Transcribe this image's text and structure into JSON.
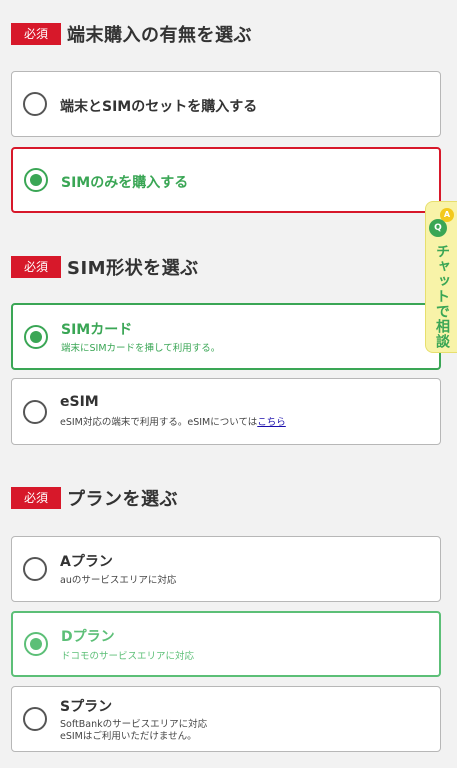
{
  "sections": [
    {
      "badge": "必須",
      "title": "端末購入の有無を選ぶ"
    },
    {
      "badge": "必須",
      "title": "SIM形状を選ぶ"
    },
    {
      "badge": "必須",
      "title": "プランを選ぶ"
    }
  ],
  "purchase": [
    {
      "label": "端末とSIMのセットを購入する",
      "selected": false
    },
    {
      "label": "SIMのみを購入する",
      "selected": true
    }
  ],
  "sim": [
    {
      "label": "SIMカード",
      "desc": "端末にSIMカードを挿して利用する。",
      "selected": true
    },
    {
      "label": "eSIM",
      "desc": "eSIM対応の端末で利用する。eSIMについては",
      "link": "こちら",
      "selected": false
    }
  ],
  "plan": [
    {
      "label": "Aプラン",
      "desc": "auのサービスエリアに対応",
      "selected": false
    },
    {
      "label": "Dプラン",
      "desc": "ドコモのサービスエリアに対応",
      "selected": true
    },
    {
      "label": "Sプラン",
      "desc": "SoftBankのサービスエリアに対応\neSIMはご利用いただけません。",
      "selected": false
    }
  ],
  "chat": {
    "a": "A",
    "q": "Q",
    "label": "チャットで相談"
  },
  "colors": {
    "required_badge": "#d7182a",
    "selected_green": "#3aa655",
    "selected_red_border": "#d7182a"
  }
}
